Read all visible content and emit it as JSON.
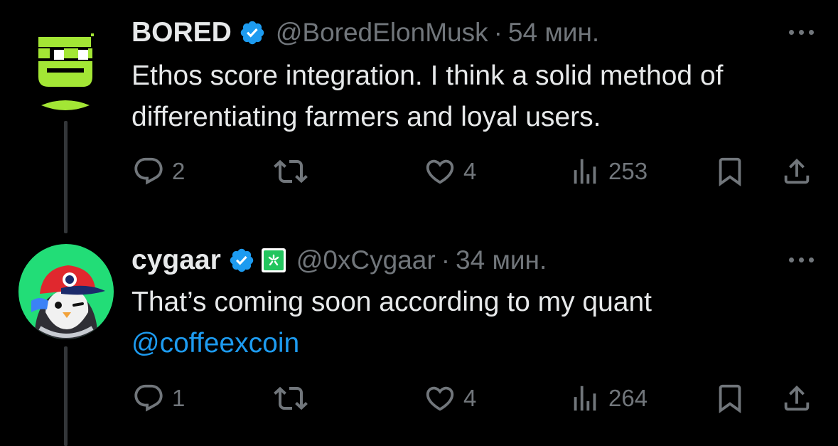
{
  "tweets": [
    {
      "name": "BORED",
      "handle": "@BoredElonMusk",
      "separator": "·",
      "time": "54 мин.",
      "text": "Ethos score integration. I think a solid method of differentiating farmers and loyal users.",
      "replies": "2",
      "likes": "4",
      "views": "253",
      "verified": true,
      "avatar_color": "#a3e635"
    },
    {
      "name": "cygaar",
      "handle": "@0xCygaar",
      "separator": "·",
      "time": "34 мин.",
      "text": "That’s coming soon according to my quant",
      "mention": "@coffeexcoin",
      "replies": "1",
      "likes": "4",
      "views": "264",
      "verified": true,
      "affiliate_badge_color": "#22c55e",
      "avatar_color": "#22dd77"
    }
  ],
  "colors": {
    "background": "#000000",
    "text": "#e7e9ea",
    "muted": "#71767b",
    "link": "#1d9bf0",
    "verified": "#1d9bf0",
    "thread_line": "#333639"
  },
  "icons": [
    "verified-badge-icon",
    "more-icon",
    "reply-icon",
    "retweet-icon",
    "like-icon",
    "views-icon",
    "bookmark-icon",
    "share-icon"
  ]
}
